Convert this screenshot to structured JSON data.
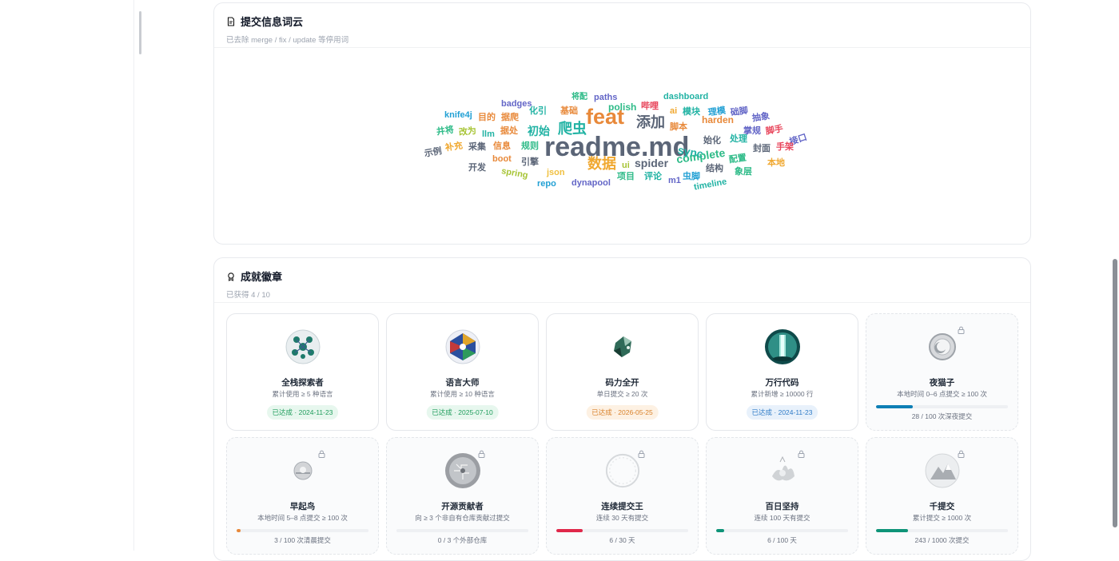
{
  "wordcloud_card": {
    "title": "提交信息词云",
    "subtitle": "已去除 merge / fix / update 等停用词",
    "words": [
      {
        "text": "readme.md",
        "color": "#5b6577"
      },
      {
        "text": "feat",
        "color": "#e8893a"
      },
      {
        "text": "爬虫",
        "color": "#22b3a4"
      },
      {
        "text": "添加",
        "color": "#5b6577"
      },
      {
        "text": "数据",
        "color": "#f0a830"
      },
      {
        "text": "初始",
        "color": "#22b3a4"
      },
      {
        "text": "spider",
        "color": "#5b6577"
      },
      {
        "text": "complete",
        "color": "#2ebb88"
      },
      {
        "text": "sync",
        "color": "#22b3a4"
      },
      {
        "text": "harden",
        "color": "#e8893a"
      },
      {
        "text": "dashboard",
        "color": "#22b3a4"
      },
      {
        "text": "badges",
        "color": "#6366c7"
      },
      {
        "text": "knife4j",
        "color": "#22a0d4"
      },
      {
        "text": "目的",
        "color": "#e8893a"
      },
      {
        "text": "据爬",
        "color": "#e8893a"
      },
      {
        "text": "化引",
        "color": "#22b3a4"
      },
      {
        "text": "将配",
        "color": "#2ebb88"
      },
      {
        "text": "paths",
        "color": "#6366c7"
      },
      {
        "text": "polish",
        "color": "#2ebb88"
      },
      {
        "text": "哔哩",
        "color": "#e8445a"
      },
      {
        "text": "ai",
        "color": "#f0a830"
      },
      {
        "text": "模块",
        "color": "#22b3a4"
      },
      {
        "text": "理模",
        "color": "#22a0d4"
      },
      {
        "text": "础脚",
        "color": "#6366c7"
      },
      {
        "text": "抽象",
        "color": "#6366c7"
      },
      {
        "text": "基础",
        "color": "#e8893a"
      },
      {
        "text": "井将",
        "color": "#2ebb88"
      },
      {
        "text": "改为",
        "color": "#a7c435"
      },
      {
        "text": "llm",
        "color": "#22b3a4"
      },
      {
        "text": "据处",
        "color": "#e8893a"
      },
      {
        "text": "脚本",
        "color": "#e8893a"
      },
      {
        "text": "掌规",
        "color": "#6366c7"
      },
      {
        "text": "脚手",
        "color": "#e8445a"
      },
      {
        "text": "接口",
        "color": "#6366c7"
      },
      {
        "text": "示例",
        "color": "#5b6577"
      },
      {
        "text": "补充",
        "color": "#f0a830"
      },
      {
        "text": "采集",
        "color": "#5b6577"
      },
      {
        "text": "信息",
        "color": "#e8893a"
      },
      {
        "text": "规则",
        "color": "#2ebb88"
      },
      {
        "text": "始化",
        "color": "#5b6577"
      },
      {
        "text": "处理",
        "color": "#22b3a4"
      },
      {
        "text": "封面",
        "color": "#5b6577"
      },
      {
        "text": "手架",
        "color": "#e8445a"
      },
      {
        "text": "boot",
        "color": "#e8893a"
      },
      {
        "text": "引擎",
        "color": "#5b6577"
      },
      {
        "text": "配置",
        "color": "#2ebb88"
      },
      {
        "text": "本地",
        "color": "#f0a830"
      },
      {
        "text": "开发",
        "color": "#5b6577"
      },
      {
        "text": "spring",
        "color": "#a7c435"
      },
      {
        "text": "json",
        "color": "#f0c040"
      },
      {
        "text": "ui",
        "color": "#a7c435"
      },
      {
        "text": "结构",
        "color": "#5b6577"
      },
      {
        "text": "象层",
        "color": "#2ebb88"
      },
      {
        "text": "项目",
        "color": "#2ebb88"
      },
      {
        "text": "评论",
        "color": "#22b3a4"
      },
      {
        "text": "m1",
        "color": "#6366c7"
      },
      {
        "text": "虫脚",
        "color": "#22a0d4"
      },
      {
        "text": "repo",
        "color": "#22a0d4"
      },
      {
        "text": "dynapool",
        "color": "#6366c7"
      },
      {
        "text": "timeline",
        "color": "#22b3a4"
      }
    ]
  },
  "achievements_card": {
    "title": "成就徽章",
    "subtitle": "已获得 4 / 10",
    "badges": [
      {
        "name": "全栈探索者",
        "desc": "累计使用 ≥ 5 种语言",
        "status": "已达成 · 2024-11-23",
        "tag_color": "green",
        "icon": "molecule-orb-icon"
      },
      {
        "name": "语言大师",
        "desc": "累计使用 ≥ 10 种语言",
        "status": "已达成 · 2025-07-10",
        "tag_color": "green",
        "icon": "prism-orb-icon"
      },
      {
        "name": "码力全开",
        "desc": "单日提交 ≥ 20 次",
        "status": "已达成 · 2026-05-25",
        "tag_color": "orange",
        "icon": "crystal-shard-icon"
      },
      {
        "name": "万行代码",
        "desc": "累计新增 ≥ 10000 行",
        "status": "已达成 · 2024-11-23",
        "tag_color": "blue",
        "icon": "waterfall-orb-icon"
      },
      {
        "name": "夜猫子",
        "desc": "本地时间 0–6 点提交 ≥ 100 次",
        "progress": 0.28,
        "progress_text": "28 / 100 次深夜提交",
        "bar_color": "#0e7fb5",
        "icon": "moon-orb-icon"
      },
      {
        "name": "早起鸟",
        "desc": "本地时间 5–8 点提交 ≥ 100 次",
        "progress": 0.03,
        "progress_text": "3 / 100 次清晨提交",
        "bar_color": "#e8893a",
        "icon": "sunrise-orb-icon"
      },
      {
        "name": "开源贡献者",
        "desc": "向 ≥ 3 个非自有仓库贡献过提交",
        "progress": 0.0,
        "progress_text": "0 / 3 个外部仓库",
        "bar_color": "#9ca3af",
        "icon": "circuit-orb-icon"
      },
      {
        "name": "连续提交王",
        "desc": "连续 30 天有提交",
        "progress": 0.2,
        "progress_text": "6 / 30 天",
        "bar_color": "#e0284a",
        "icon": "ring-icon"
      },
      {
        "name": "百日坚持",
        "desc": "连续 100 天有提交",
        "progress": 0.06,
        "progress_text": "6 / 100 天",
        "bar_color": "#0e9478",
        "icon": "splash-icon"
      },
      {
        "name": "千提交",
        "desc": "累计提交 ≥ 1000 次",
        "progress": 0.243,
        "progress_text": "243 / 1000 次提交",
        "bar_color": "#0e9478",
        "icon": "mountain-orb-icon"
      }
    ]
  }
}
